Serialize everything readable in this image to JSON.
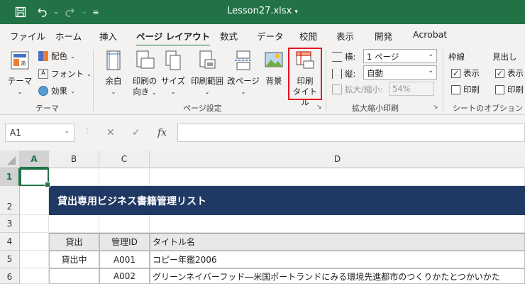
{
  "window": {
    "title": "Lesson27.xlsx"
  },
  "ribbon_tabs": [
    "ファイル",
    "ホーム",
    "挿入",
    "ページ レイアウト",
    "数式",
    "データ",
    "校閲",
    "表示",
    "開発",
    "Acrobat"
  ],
  "theme_group": {
    "label": "テーマ",
    "theme_btn": "テーマ",
    "colors": "配色",
    "fonts": "フォント",
    "effects": "効果"
  },
  "page_setup_group": {
    "label": "ページ設定",
    "margins": [
      "余白"
    ],
    "orientation": [
      "印刷の",
      "向き"
    ],
    "size": [
      "サイズ"
    ],
    "print_area": [
      "印刷範囲"
    ],
    "breaks": [
      "改ページ"
    ],
    "background": [
      "背景"
    ],
    "print_titles": [
      "印刷",
      "タイトル"
    ]
  },
  "scale_group": {
    "label": "拡大縮小印刷",
    "width_label": "横:",
    "width_value": "1 ページ",
    "height_label": "縦:",
    "height_value": "自動",
    "scale_label": "拡大/縮小:",
    "scale_value": "54%"
  },
  "sheet_options_group": {
    "label": "シートのオプション",
    "gridlines": "枠線",
    "headings": "見出し",
    "view": "表示",
    "print": "印刷"
  },
  "formula_bar": {
    "name_box": "A1",
    "cancel": "✕",
    "enter": "✓",
    "fx": "fx"
  },
  "columns": [
    "A",
    "B",
    "C",
    "D"
  ],
  "rows": [
    "1",
    "2",
    "3",
    "4",
    "5",
    "6"
  ],
  "sheet": {
    "title": "貸出専用ビジネス書籍管理リスト",
    "header": {
      "loan": "貸出",
      "id": "管理ID",
      "title": "タイトル名"
    },
    "rows": [
      {
        "loan": "貸出中",
        "id": "A001",
        "title": "コピー年鑑2006"
      },
      {
        "loan": "",
        "id": "A002",
        "title": "グリーンネイバーフッド―米国ポートランドにみる環境先進都市のつくりかたとつかいかた"
      }
    ]
  }
}
